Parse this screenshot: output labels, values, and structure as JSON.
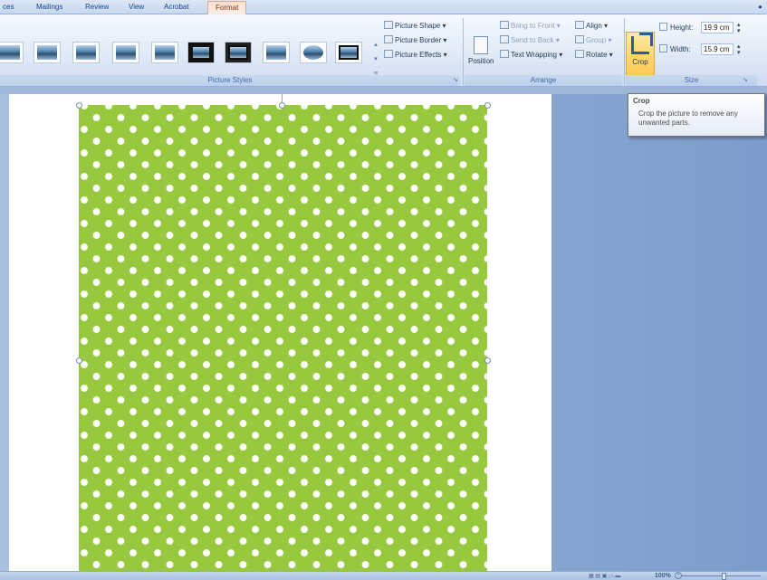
{
  "tabs": [
    {
      "label": "ces"
    },
    {
      "label": "Mailings"
    },
    {
      "label": "Review"
    },
    {
      "label": "View"
    },
    {
      "label": "Acrobat"
    },
    {
      "label": "Format",
      "active": true
    }
  ],
  "picture_styles": {
    "group_label": "Picture Styles",
    "shape_label": "Picture Shape",
    "border_label": "Picture Border",
    "effects_label": "Picture Effects"
  },
  "arrange": {
    "group_label": "Arrange",
    "position_label": "Position",
    "bring_to_front": "Bring to Front",
    "send_to_back": "Send to Back",
    "text_wrapping": "Text Wrapping",
    "align": "Align",
    "group": "Group",
    "rotate": "Rotate"
  },
  "size": {
    "group_label": "Size",
    "crop_label": "Crop",
    "height_label": "Height:",
    "height_value": "19.9 cm",
    "width_label": "Width:",
    "width_value": "15.9 cm"
  },
  "tooltip": {
    "title": "Crop",
    "body": "Crop the picture to remove any unwanted parts."
  },
  "status": {
    "zoom": "100%"
  },
  "colors": {
    "picture_green": "#97c83d",
    "dot_white": "#ffffff",
    "active_tab": "#fde0d0",
    "crop_highlight": "#ffd466"
  }
}
